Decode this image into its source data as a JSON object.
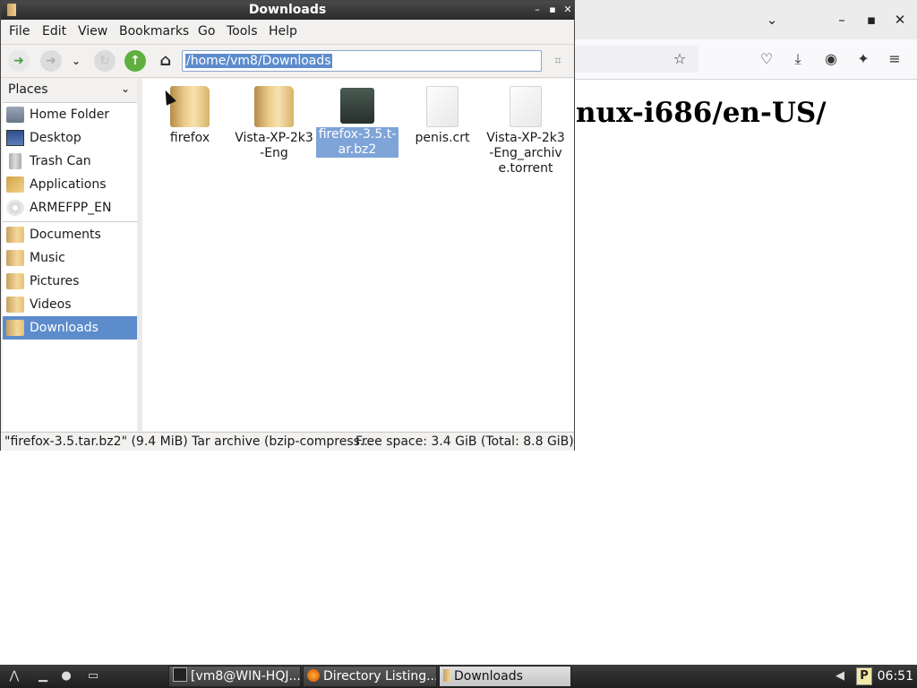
{
  "browser": {
    "page_heading": "nux-i686/en-US/",
    "window_controls": [
      "chevron-down-icon",
      "minimize-icon",
      "maximize-icon",
      "close-icon"
    ],
    "toolbar_icons": [
      "bookmark-star-icon",
      "pocket-icon",
      "download-icon",
      "account-icon",
      "extensions-icon",
      "menu-icon"
    ]
  },
  "file_manager": {
    "title": "Downloads",
    "menu": [
      "File",
      "Edit",
      "View",
      "Bookmarks",
      "Go",
      "Tools",
      "Help"
    ],
    "path": "/home/vm8/Downloads",
    "sidebar": {
      "header": "Places",
      "places": [
        {
          "label": "Home Folder",
          "icon": "home-folder-icon"
        },
        {
          "label": "Desktop",
          "icon": "desktop-icon"
        },
        {
          "label": "Trash Can",
          "icon": "trash-icon"
        },
        {
          "label": "Applications",
          "icon": "applications-icon"
        },
        {
          "label": "ARMEFPP_EN",
          "icon": "disc-icon"
        }
      ],
      "bookmarks": [
        {
          "label": "Documents",
          "icon": "folder-icon"
        },
        {
          "label": "Music",
          "icon": "folder-icon"
        },
        {
          "label": "Pictures",
          "icon": "folder-icon"
        },
        {
          "label": "Videos",
          "icon": "folder-icon"
        },
        {
          "label": "Downloads",
          "icon": "folder-icon",
          "selected": true
        }
      ]
    },
    "files": [
      {
        "name": "firefox",
        "type": "folder"
      },
      {
        "name": "Vista-XP-2k3-Eng",
        "type": "folder"
      },
      {
        "name": "firefox-3.5.tar.bz2",
        "display": "firefox-3.5.t-ar.bz2",
        "type": "archive",
        "selected": true
      },
      {
        "name": "penis.crt",
        "type": "document"
      },
      {
        "name": "Vista-XP-2k3-Eng_archive.torrent",
        "display": "Vista-XP-2k3-Eng_archive.torrent",
        "type": "document"
      }
    ],
    "status": {
      "selection": "\"firefox-3.5.tar.bz2\" (9.4 MiB) Tar archive (bzip-compress...",
      "free_space": "Free space: 3.4 GiB (Total: 8.8 GiB)"
    }
  },
  "taskbar": {
    "tasks": [
      {
        "label": "[vm8@WIN-HQJ...",
        "icon": "terminal-icon"
      },
      {
        "label": "Directory Listing...",
        "icon": "firefox-icon"
      },
      {
        "label": "Downloads",
        "icon": "folder-icon",
        "active": true
      }
    ],
    "clock": "06:51"
  },
  "colors": {
    "selection": "#5d8ccc",
    "titlebar": "#2b2b2b",
    "taskbar": "#1e1e1e"
  }
}
